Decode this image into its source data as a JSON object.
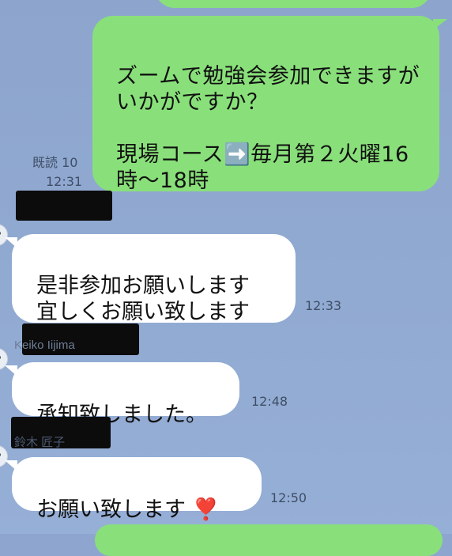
{
  "chat": {
    "messages": [
      {
        "side": "outgoing",
        "text": "ズームで勉強会参加できますがいかがですか？\n\n現場コース➡️毎月第２火曜16時〜18時",
        "read_label": "既読 10",
        "time": "12:31"
      },
      {
        "side": "incoming",
        "sender": "",
        "text": "是非参加お願いします\n宜しくお願い致します",
        "time": "12:33"
      },
      {
        "side": "incoming",
        "sender": "Keiko Iijima",
        "text": "承知致しました。",
        "time": "12:48"
      },
      {
        "side": "incoming",
        "sender": "鈴木 匠子",
        "text": "お願い致します ❣️",
        "time": "12:50"
      }
    ]
  }
}
